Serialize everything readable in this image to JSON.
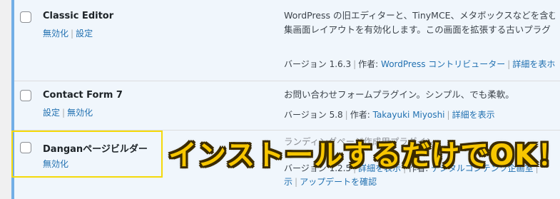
{
  "plugins": [
    {
      "name": "Classic Editor",
      "actions": [
        "無効化",
        "設定"
      ],
      "description_lines": [
        "WordPress の旧エディターと、TinyMCE、メタボックスなどを含む",
        "集画面レイアウトを有効化します。この画面を拡張する古いプラグ"
      ],
      "version_label": "バージョン 1.6.3",
      "author_prefix": "作者:",
      "author": "WordPress コントリビューター",
      "details": "詳細を表ホ"
    },
    {
      "name": "Contact Form 7",
      "actions": [
        "設定",
        "無効化"
      ],
      "description_lines": [
        "お問い合わせフォームプラグイン。シンプル、でも柔軟。"
      ],
      "version_label": "バージョン 5.8",
      "author_prefix": "作者:",
      "author": "Takayuki Miyoshi",
      "details": "詳細を表示"
    },
    {
      "name": "Danganページビルダー",
      "actions": [
        "無効化"
      ],
      "description_lines": [
        "ランディングページ作成用プラグイン"
      ],
      "version_label": "バージョン 1.2.5",
      "details": "詳細を表示",
      "author_prefix": "作者:",
      "author": "デジタルコンテンツ企画室",
      "meta_line2_start": "示",
      "update_link": "アップデートを確認"
    }
  ],
  "overlay_text": "インストールするだけでOK！",
  "colors": {
    "active_row_bg": "#f0f6fc",
    "accent": "#72aee6",
    "link": "#2271b1",
    "highlight_border": "#f5d90a",
    "overlay_fill": "#f7c600"
  }
}
